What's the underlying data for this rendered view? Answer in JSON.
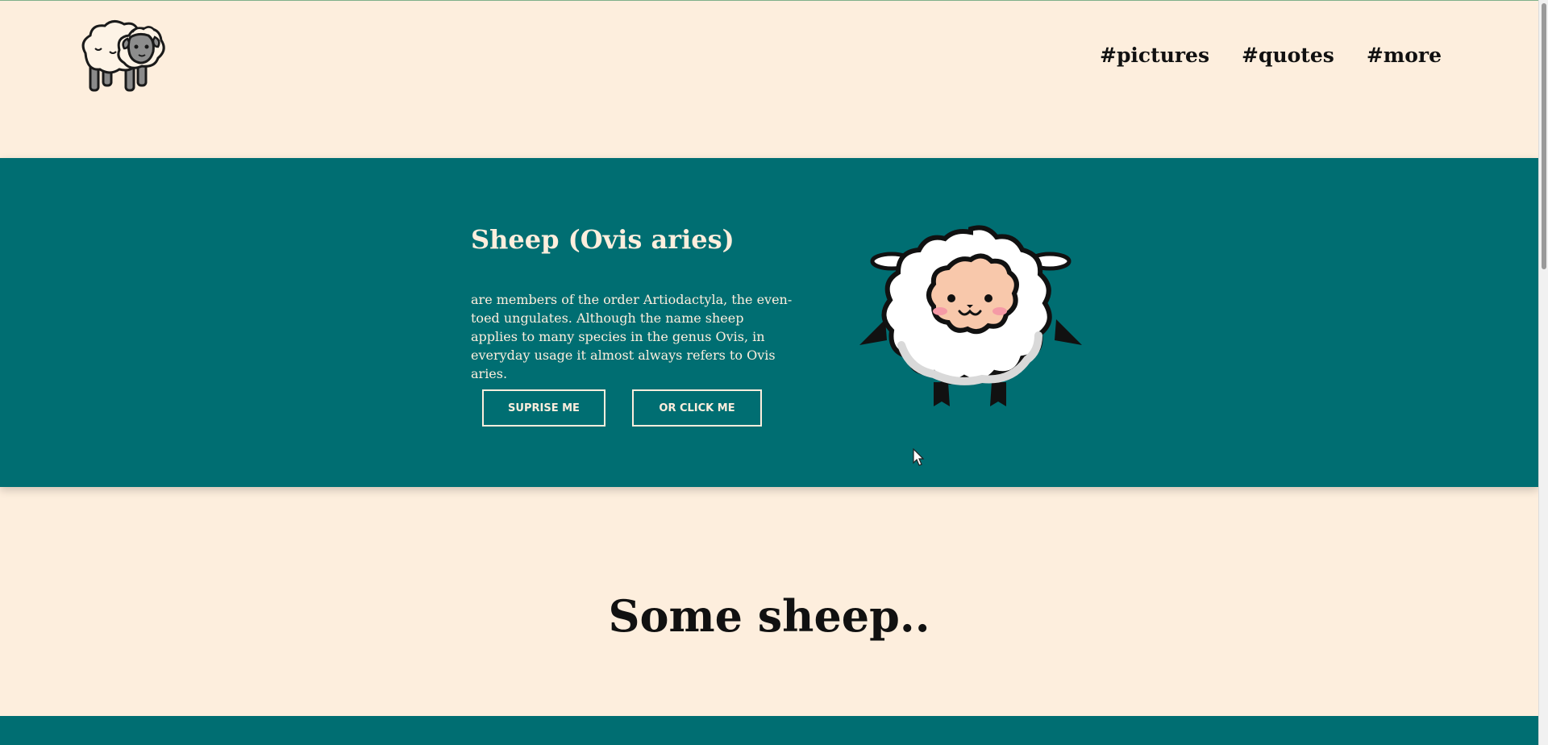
{
  "nav": {
    "items": [
      {
        "label": "#pictures"
      },
      {
        "label": "#quotes"
      },
      {
        "label": "#more"
      }
    ]
  },
  "hero": {
    "title": "Sheep (Ovis aries)",
    "text": "are members of the order Artiodactyla, the even-toed ungulates. Although the name sheep applies to many species in the genus Ovis, in everyday usage it almost always refers to Ovis aries.",
    "buttons": {
      "surprise": "SUPRISE ME",
      "click": "OR CLICK ME"
    }
  },
  "section": {
    "title": "Some sheep.."
  },
  "icons": {
    "logo": "sheep-pair-logo",
    "hero_image": "sheep-illustration",
    "cursor": "mouse-pointer"
  },
  "colors": {
    "background": "#fdeedd",
    "teal": "#006e72",
    "text_dark": "#111111",
    "text_light": "#fdeedd"
  }
}
